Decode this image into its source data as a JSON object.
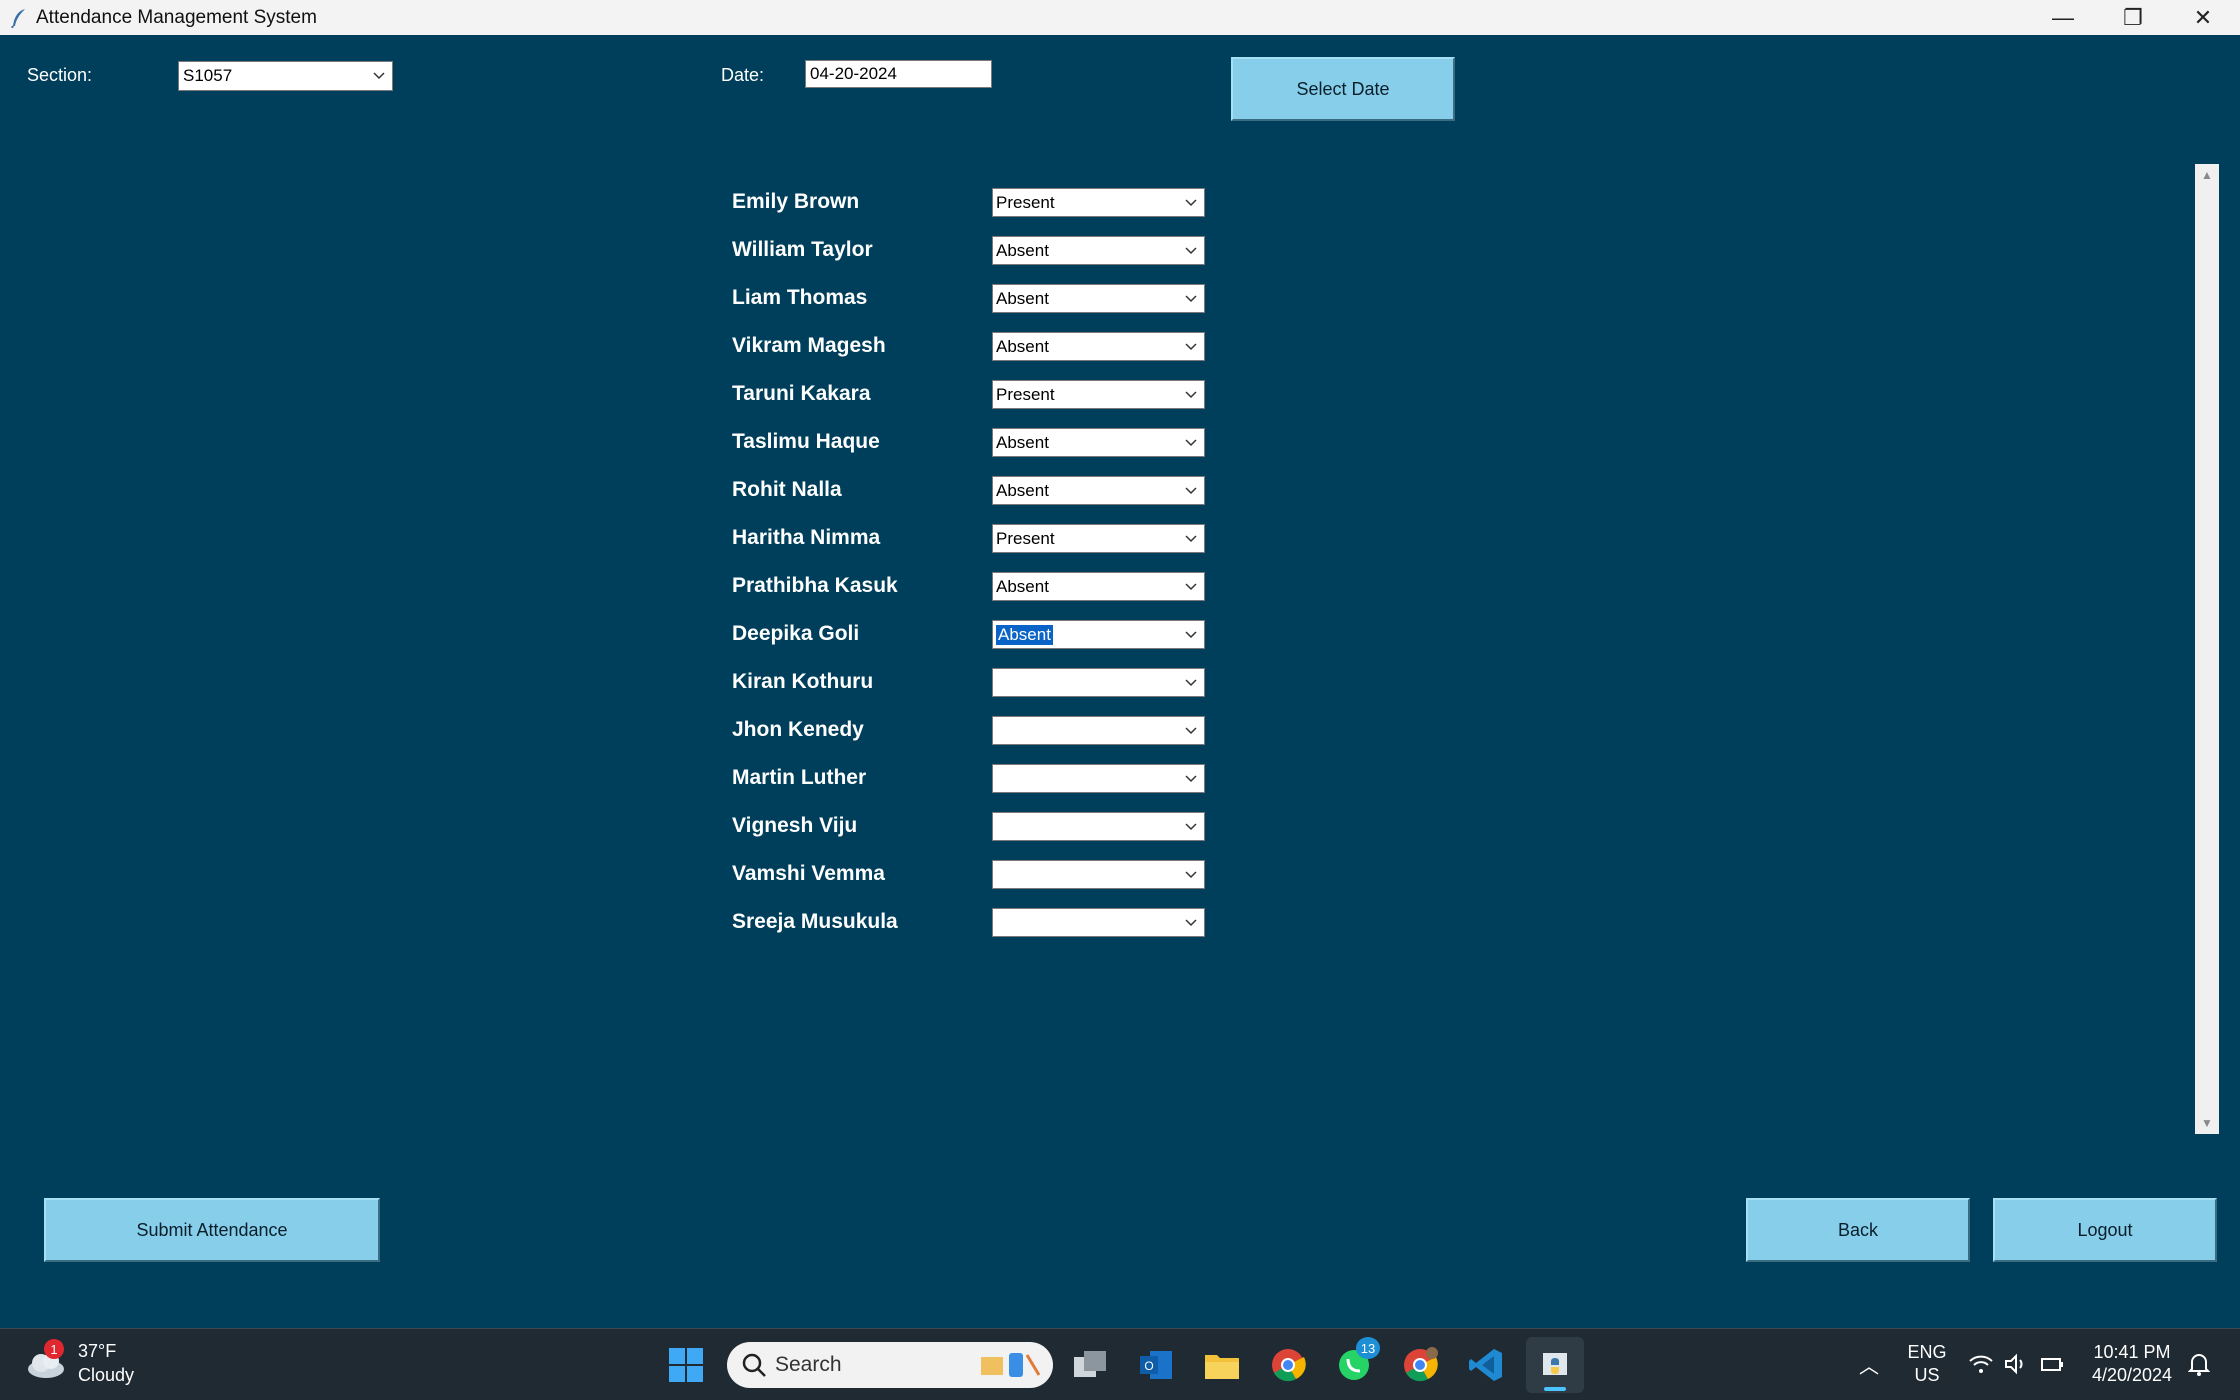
{
  "window": {
    "title": "Attendance Management System",
    "minimize": "—",
    "maximize": "❐",
    "close": "✕"
  },
  "form": {
    "section_label": "Section:",
    "section_value": "S1057",
    "date_label": "Date:",
    "date_value": "04-20-2024",
    "select_date_button": "Select Date"
  },
  "students": [
    {
      "name": "Emily Brown",
      "status": "Present"
    },
    {
      "name": "William Taylor",
      "status": "Absent"
    },
    {
      "name": "Liam Thomas",
      "status": "Absent"
    },
    {
      "name": "Vikram Magesh",
      "status": "Absent"
    },
    {
      "name": "Taruni Kakara",
      "status": "Present"
    },
    {
      "name": "Taslimu Haque",
      "status": "Absent"
    },
    {
      "name": "Rohit Nalla",
      "status": "Absent"
    },
    {
      "name": "Haritha Nimma",
      "status": "Present"
    },
    {
      "name": "Prathibha Kasuk",
      "status": "Absent"
    },
    {
      "name": "Deepika Goli",
      "status": "Absent"
    },
    {
      "name": "Kiran Kothuru",
      "status": ""
    },
    {
      "name": "Jhon Kenedy",
      "status": ""
    },
    {
      "name": "Martin Luther",
      "status": ""
    },
    {
      "name": "Vignesh Viju",
      "status": ""
    },
    {
      "name": "Vamshi Vemma",
      "status": ""
    },
    {
      "name": "Sreeja Musukula",
      "status": ""
    }
  ],
  "actions": {
    "submit": "Submit Attendance",
    "back": "Back",
    "logout": "Logout"
  },
  "taskbar": {
    "weather_temp": "37°F",
    "weather_desc": "Cloudy",
    "weather_badge": "1",
    "search_placeholder": "Search",
    "whatsapp_badge": "13",
    "lang_line1": "ENG",
    "lang_line2": "US",
    "time": "10:41 PM",
    "date": "4/20/2024"
  },
  "colors": {
    "background": "#003f5b",
    "button": "#87ceeb",
    "selection": "#0a64c8"
  }
}
